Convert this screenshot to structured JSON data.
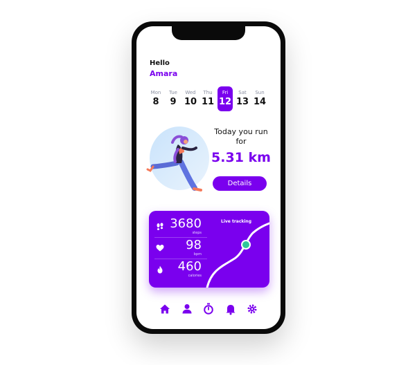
{
  "greeting": {
    "hello": "Hello",
    "name": "Amara"
  },
  "week": [
    {
      "name": "Mon",
      "date": "8"
    },
    {
      "name": "Tue",
      "date": "9"
    },
    {
      "name": "Wed",
      "date": "10"
    },
    {
      "name": "Thu",
      "date": "11"
    },
    {
      "name": "Fri",
      "date": "12",
      "active": true
    },
    {
      "name": "Sat",
      "date": "13"
    },
    {
      "name": "Sun",
      "date": "14"
    }
  ],
  "run": {
    "title": "Today you run for",
    "distance": "5.31 km",
    "details_label": "Details"
  },
  "stats": {
    "steps": {
      "value": "3680",
      "unit": "steps",
      "icon": "footsteps-icon"
    },
    "heart": {
      "value": "98",
      "unit": "bpm",
      "icon": "heart-icon"
    },
    "calories": {
      "value": "460",
      "unit": "calories",
      "icon": "flame-icon"
    },
    "live_label": "Live tracking"
  },
  "tabs": [
    {
      "icon": "home-icon"
    },
    {
      "icon": "profile-icon"
    },
    {
      "icon": "stopwatch-icon"
    },
    {
      "icon": "bell-icon"
    },
    {
      "icon": "settings-icon"
    }
  ],
  "colors": {
    "accent": "#7a00ee",
    "tracker": "#2fc79a"
  }
}
